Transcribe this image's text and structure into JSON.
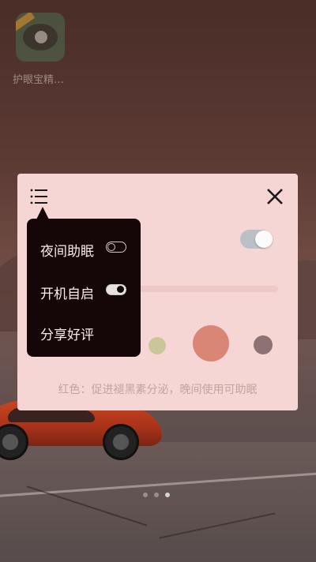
{
  "home_screen": {
    "app_label": "护眼宝精…",
    "app_icon": "eye-app-icon",
    "page_indicator": {
      "count": 3,
      "active_index": 2
    }
  },
  "dialog": {
    "menu_icon": "menu-list-icon",
    "close_icon": "close-icon",
    "filter_toggle_on": true,
    "swatches": [
      {
        "name": "green",
        "color": "#c9c79a"
      },
      {
        "name": "red",
        "color": "#d98677"
      },
      {
        "name": "dark",
        "color": "#8c7274"
      }
    ],
    "selected_swatch": "red",
    "description": "红色：促进褪黑素分泌，晚间使用可助眠"
  },
  "menu": {
    "items": [
      {
        "label": "夜间助眠",
        "toggle": true,
        "on": false
      },
      {
        "label": "开机自启",
        "toggle": true,
        "on": true
      },
      {
        "label": "分享好评",
        "toggle": false
      }
    ]
  },
  "colors": {
    "dialog_bg": "#f5d6d4",
    "menu_bg": "#150608"
  }
}
